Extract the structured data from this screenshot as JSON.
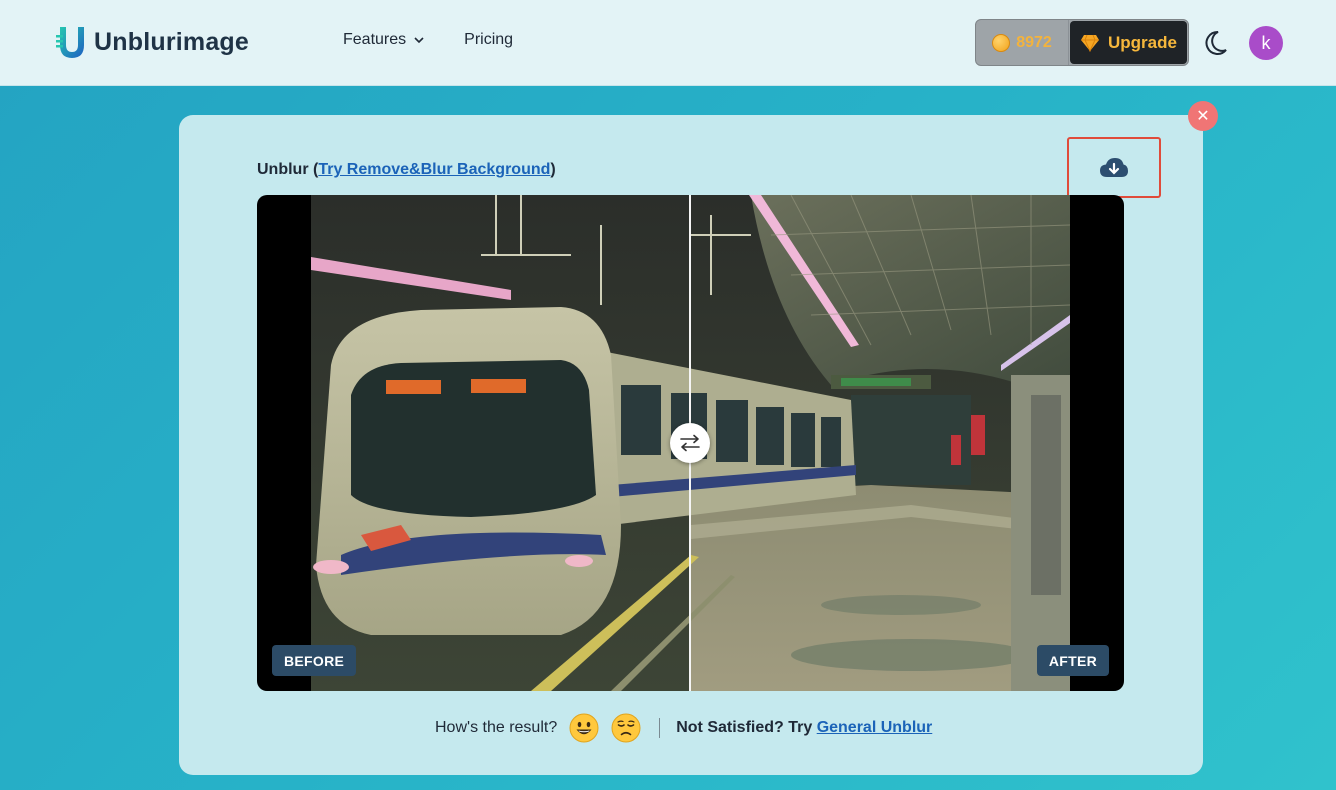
{
  "header": {
    "logo_text": "Unblurimage",
    "nav": [
      {
        "label": "Features",
        "has_dropdown": true
      },
      {
        "label": "Pricing",
        "has_dropdown": false
      }
    ],
    "credits": "8972",
    "upgrade_label": "Upgrade",
    "avatar_letter": "k"
  },
  "card": {
    "title_prefix": "Unblur (",
    "title_link": "Try Remove&Blur Background",
    "title_suffix": ")",
    "before_label": "BEFORE",
    "after_label": "AFTER",
    "feedback_question": "How's the result?",
    "not_satisfied": "Not Satisfied? Try ",
    "not_satisfied_link": "General Unblur"
  },
  "colors": {
    "accent": "#1b63b8",
    "upgrade_text": "#f6b73c",
    "highlight_box": "#e04b3a",
    "avatar_bg": "#a94cc9"
  }
}
